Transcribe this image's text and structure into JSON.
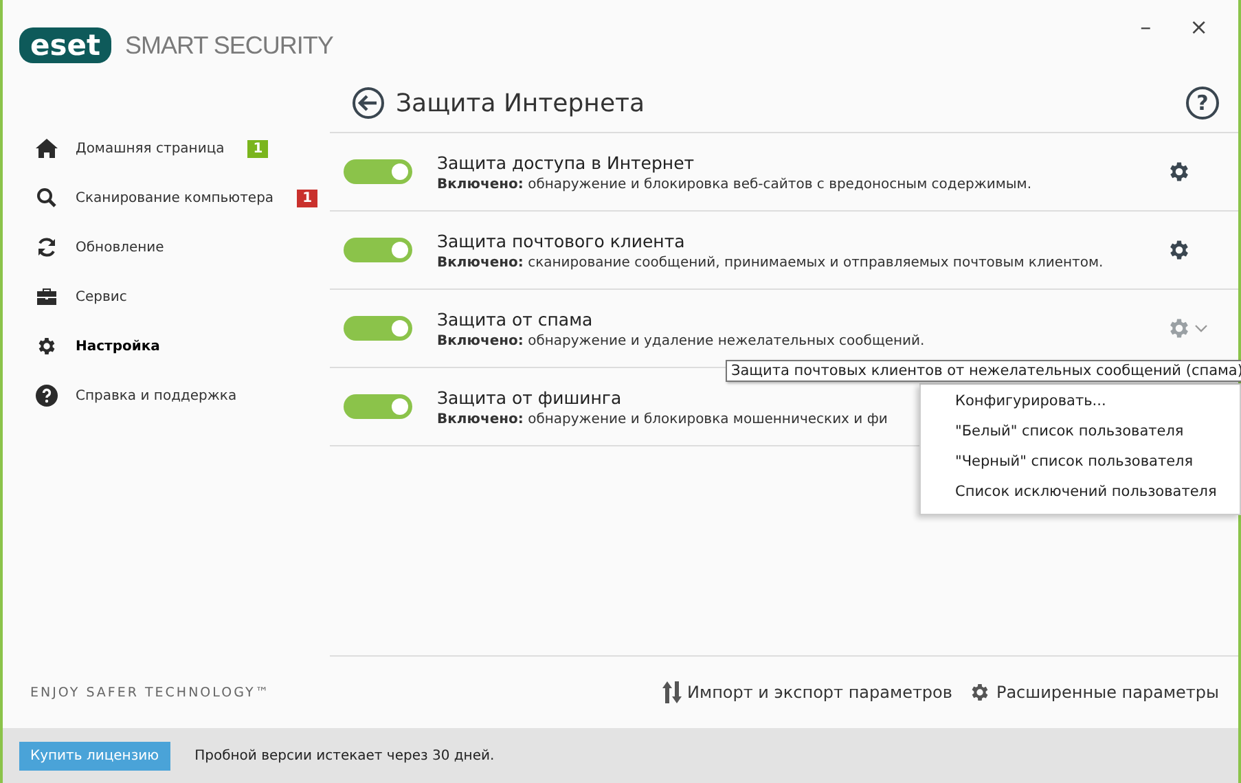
{
  "app": {
    "brand": "eset",
    "product": "SMART SECURITY",
    "tagline": "ENJOY SAFER TECHNOLOGY™"
  },
  "window_controls": {
    "minimize": "–",
    "close": "×"
  },
  "sidebar": {
    "items": [
      {
        "label": "Домашняя страница",
        "kind": "home",
        "selected": false,
        "badge": "1",
        "color": "#7ab51d"
      },
      {
        "label": "Сканирование компьютера",
        "kind": "search",
        "selected": false,
        "badge": "1",
        "color": "#c9302c"
      },
      {
        "label": "Обновление",
        "kind": "refresh",
        "selected": false
      },
      {
        "label": "Сервис",
        "kind": "briefcase",
        "selected": false
      },
      {
        "label": "Настройка",
        "kind": "gear",
        "selected": true
      },
      {
        "label": "Справка и поддержка",
        "kind": "help",
        "selected": false
      }
    ]
  },
  "page": {
    "title": "Защита Интернета",
    "help": "?"
  },
  "settings": [
    {
      "title": "Защита доступа в Интернет",
      "status": "Включено:",
      "description": "обнаружение и блокировка веб-сайтов с вредоносным содержимым.",
      "on": true,
      "menu_open": false
    },
    {
      "title": "Защита почтового клиента",
      "status": "Включено:",
      "description": "сканирование сообщений, принимаемых и отправляемых почтовым клиентом.",
      "on": true,
      "menu_open": false
    },
    {
      "title": "Защита от спама",
      "status": "Включено:",
      "description": "обнаружение и удаление нежелательных сообщений.",
      "on": true,
      "menu_open": true
    },
    {
      "title": "Защита от фишинга",
      "status": "Включено:",
      "description": "обнаружение и блокировка мошеннических и фи",
      "on": true,
      "menu_open": false
    }
  ],
  "tooltip": "Защита почтовых клиентов от нежелательных сообщений (спама)",
  "context_menu": [
    "Конфигурировать...",
    "\"Белый\" список пользователя",
    "\"Черный\" список пользователя",
    "Список исключений пользователя"
  ],
  "footer_links": [
    "Импорт и экспорт параметров",
    "Расширенные параметры"
  ],
  "status_bar": {
    "button": "Купить лицензию",
    "message": "Пробной версии истекает через 30 дней."
  }
}
